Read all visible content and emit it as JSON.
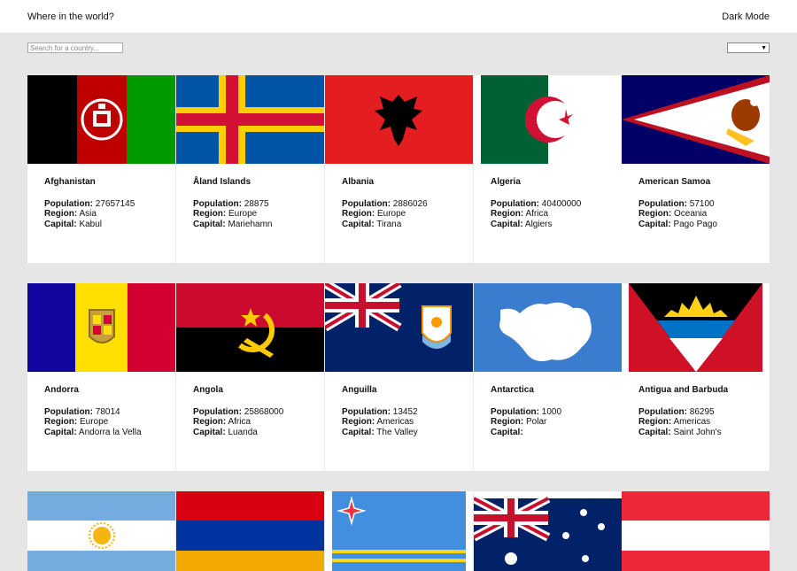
{
  "header": {
    "title": "Where in the world?",
    "mode_label": "Dark Mode"
  },
  "search": {
    "placeholder": "Search for a country...",
    "value": ""
  },
  "filter": {
    "selected": ""
  },
  "labels": {
    "population": "Population:",
    "region": "Region:",
    "capital": "Capital:"
  },
  "countries": [
    {
      "name": "Afghanistan",
      "population": "27657145",
      "region": "Asia",
      "capital": "Kabul"
    },
    {
      "name": "Åland Islands",
      "population": "28875",
      "region": "Europe",
      "capital": "Mariehamn"
    },
    {
      "name": "Albania",
      "population": "2886026",
      "region": "Europe",
      "capital": "Tirana"
    },
    {
      "name": "Algeria",
      "population": "40400000",
      "region": "Africa",
      "capital": "Algiers"
    },
    {
      "name": "American Samoa",
      "population": "57100",
      "region": "Oceania",
      "capital": "Pago Pago"
    },
    {
      "name": "Andorra",
      "population": "78014",
      "region": "Europe",
      "capital": "Andorra la Vella"
    },
    {
      "name": "Angola",
      "population": "25868000",
      "region": "Africa",
      "capital": "Luanda"
    },
    {
      "name": "Anguilla",
      "population": "13452",
      "region": "Americas",
      "capital": "The Valley"
    },
    {
      "name": "Antarctica",
      "population": "1000",
      "region": "Polar",
      "capital": ""
    },
    {
      "name": "Antigua and Barbuda",
      "population": "86295",
      "region": "Americas",
      "capital": "Saint John's"
    }
  ]
}
